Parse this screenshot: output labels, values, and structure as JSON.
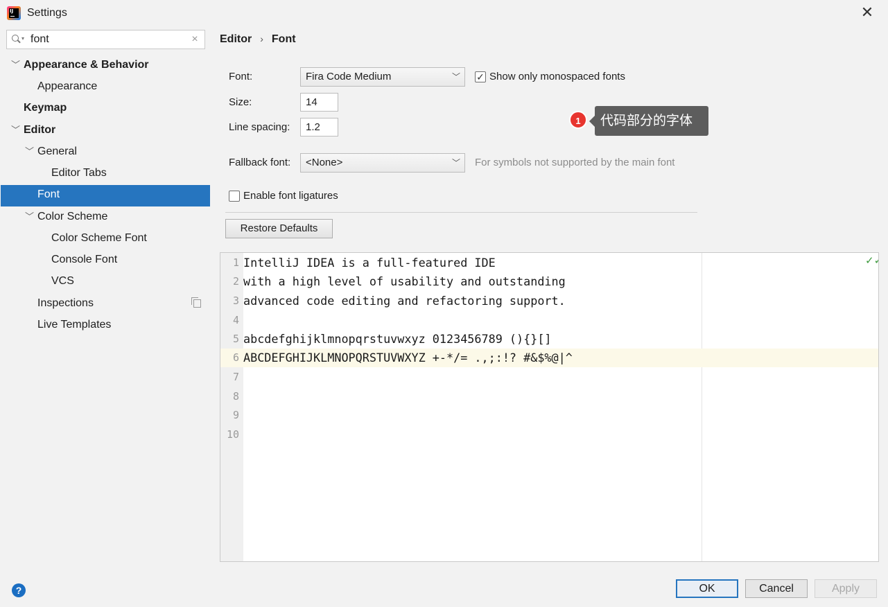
{
  "window": {
    "title": "Settings",
    "close_glyph": "✕",
    "app_icon": "intellij-idea-icon",
    "app_icon_text": "IJ"
  },
  "search": {
    "value": "font",
    "clear_glyph": "×"
  },
  "sidebar": {
    "items": [
      {
        "label": "Appearance & Behavior",
        "bold": true,
        "chevron": "expanded"
      },
      {
        "label": "Appearance"
      },
      {
        "label": "Keymap",
        "bold": true
      },
      {
        "label": "Editor",
        "bold": true,
        "chevron": "expanded"
      },
      {
        "label": "General",
        "chevron": "expanded"
      },
      {
        "label": "Editor Tabs"
      },
      {
        "label": "Font",
        "selected": true
      },
      {
        "label": "Color Scheme",
        "chevron": "expanded"
      },
      {
        "label": "Color Scheme Font"
      },
      {
        "label": "Console Font"
      },
      {
        "label": "VCS"
      },
      {
        "label": "Inspections",
        "icon": "copy-icon"
      },
      {
        "label": "Live Templates"
      }
    ]
  },
  "breadcrumb": {
    "part1": "Editor",
    "sep": "›",
    "part2": "Font"
  },
  "form": {
    "font_label": "Font:",
    "font_value": "Fira Code Medium",
    "mono_label": "Show only monospaced fonts",
    "mono_checked": true,
    "size_label": "Size:",
    "size_value": "14",
    "spacing_label": "Line spacing:",
    "spacing_value": "1.2",
    "fallback_label": "Fallback font:",
    "fallback_value": "<None>",
    "fallback_hint": "For symbols not supported by the main font",
    "ligatures_label": "Enable font ligatures",
    "ligatures_checked": false,
    "restore_label": "Restore Defaults"
  },
  "annotation": {
    "number": "1",
    "text": "代码部分的字体"
  },
  "preview": {
    "lines": [
      {
        "num": "1",
        "code": "IntelliJ IDEA is a full-featured IDE"
      },
      {
        "num": "2",
        "code": "with a high level of usability and outstanding"
      },
      {
        "num": "3",
        "code": "advanced code editing and refactoring support."
      },
      {
        "num": "4",
        "code": ""
      },
      {
        "num": "5",
        "code": "abcdefghijklmnopqrstuvwxyz 0123456789 (){}[]"
      },
      {
        "num": "6",
        "code": "ABCDEFGHIJKLMNOPQRSTUVWXYZ +-*/= .,;:!? #&$%@|^",
        "current": true
      },
      {
        "num": "7",
        "code": ""
      },
      {
        "num": "8",
        "code": ""
      },
      {
        "num": "9",
        "code": ""
      },
      {
        "num": "10",
        "code": ""
      }
    ],
    "status_icon": "double-check-icon"
  },
  "footer": {
    "help": "?",
    "ok": "OK",
    "cancel": "Cancel",
    "apply": "Apply",
    "apply_enabled": false
  },
  "colors": {
    "selection": "#2675bf",
    "current_line": "#fcf9e8",
    "marker": "#e8352f",
    "tooltip": "#5d5d5d"
  }
}
